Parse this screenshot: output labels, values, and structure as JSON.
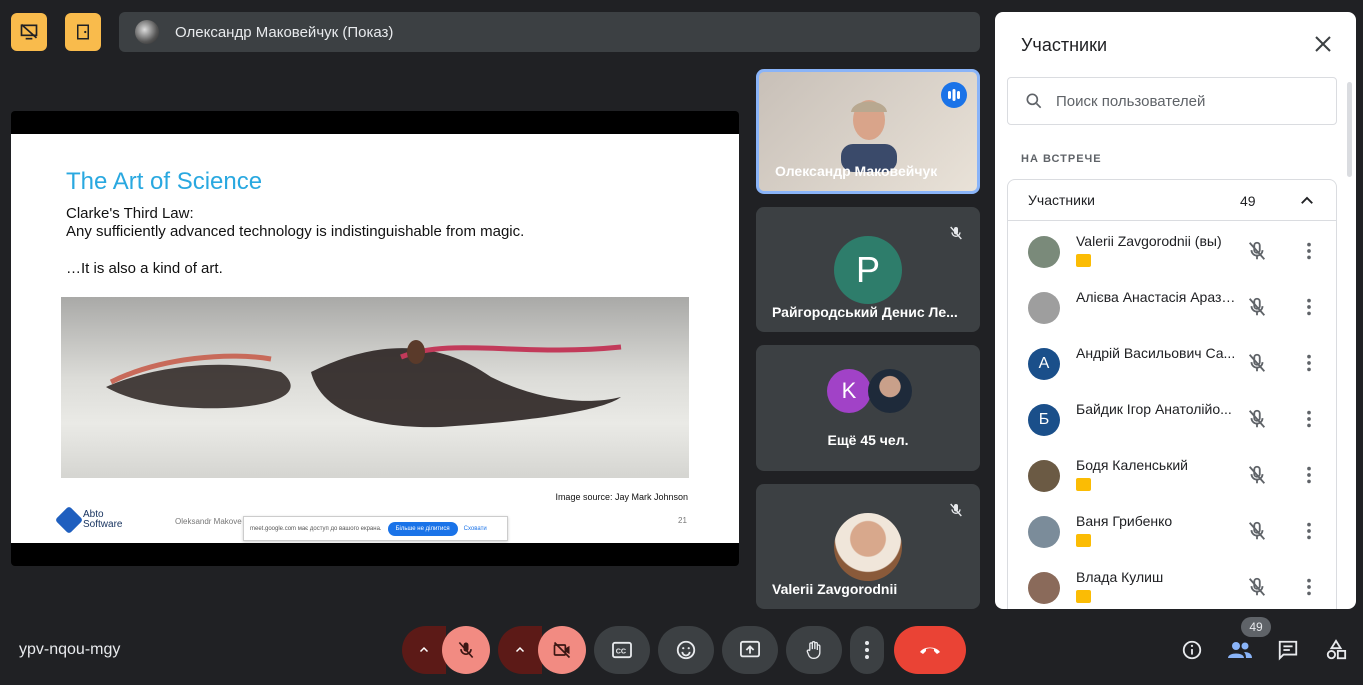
{
  "header": {
    "presenter_label": "Олександр Маковейчук (Показ)"
  },
  "slide": {
    "title": "The Art of Science",
    "line1": "Clarke's Third Law:",
    "line2": "Any sufficiently advanced technology is indistinguishable from magic.",
    "line3": "…It is also a kind of art.",
    "image_source": "Image source: Jay Mark Johnson",
    "logo_line1": "Abto",
    "logo_line2": "Software",
    "footer_author": "Oleksandr Makove",
    "page_number": "21",
    "share_banner_text": "meet.google.com має доступ до вашого екрана.",
    "share_banner_stop": "Більше не ділитися",
    "share_banner_hide": "Сховати"
  },
  "tiles": [
    {
      "name": "Олександр Маковейчук"
    },
    {
      "name": "Райгородський Денис Ле...",
      "initial": "P",
      "color": "#2e7d6b"
    },
    {
      "name": "Ещё 45 чел.",
      "initial": "K",
      "color": "#a142c7"
    },
    {
      "name": "Valerii Zavgorodnii"
    }
  ],
  "panel": {
    "title": "Участники",
    "search_placeholder": "Поиск пользователей",
    "section_label": "НА ВСТРЕЧЕ",
    "group_label": "Участники",
    "group_count": "49",
    "people": [
      {
        "name": "Valerii Zavgorodnii (вы)",
        "badge": true,
        "avatar_color": "#7a8a7a",
        "initial": ""
      },
      {
        "name": "Алієва Анастасія Аразі...",
        "badge": false,
        "avatar_color": "#9e9e9e",
        "initial": ""
      },
      {
        "name": "Андрій Васильович Са...",
        "badge": false,
        "avatar_color": "#1a4f8a",
        "initial": "А"
      },
      {
        "name": "Байдик Ігор Анатолійо...",
        "badge": false,
        "avatar_color": "#1a4f8a",
        "initial": "Б"
      },
      {
        "name": "Бодя Каленський",
        "badge": true,
        "avatar_color": "#6b5a44",
        "initial": ""
      },
      {
        "name": "Ваня Грибенко",
        "badge": true,
        "avatar_color": "#7b8c9a",
        "initial": ""
      },
      {
        "name": "Влада Кулиш",
        "badge": true,
        "avatar_color": "#8a6a5a",
        "initial": ""
      }
    ]
  },
  "footer": {
    "meeting_code": "ypv-nqou-mgy",
    "participants_count": "49"
  }
}
